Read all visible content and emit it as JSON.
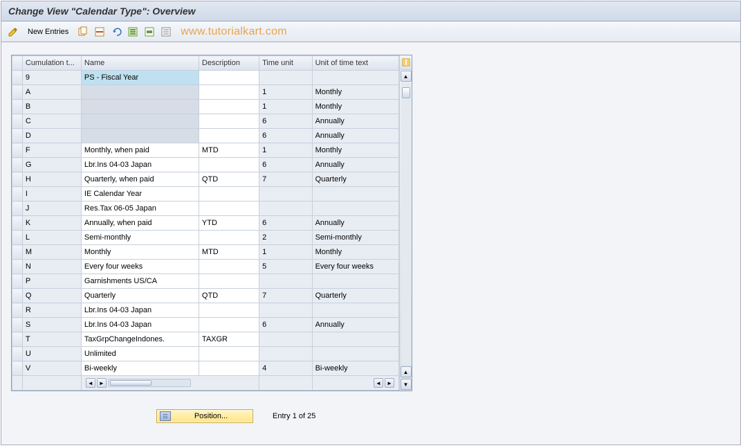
{
  "title": "Change View \"Calendar Type\": Overview",
  "toolbar": {
    "new_entries_label": "New Entries"
  },
  "watermark": "www.tutorialkart.com",
  "table": {
    "headers": {
      "cumulation": "Cumulation t...",
      "name": "Name",
      "description": "Description",
      "time_unit": "Time unit",
      "unit_of_time_text": "Unit of time text"
    },
    "rows": [
      {
        "ct": "9",
        "name": "PS - Fiscal Year",
        "desc": "",
        "tu": "",
        "uott": "",
        "selected": true
      },
      {
        "ct": "A",
        "name": "",
        "desc": "",
        "tu": "1",
        "uott": "Monthly"
      },
      {
        "ct": "B",
        "name": "",
        "desc": "",
        "tu": "1",
        "uott": "Monthly"
      },
      {
        "ct": "C",
        "name": "",
        "desc": "",
        "tu": "6",
        "uott": "Annually"
      },
      {
        "ct": "D",
        "name": "",
        "desc": "",
        "tu": "6",
        "uott": "Annually"
      },
      {
        "ct": "F",
        "name": "Monthly, when paid",
        "desc": "MTD",
        "tu": "1",
        "uott": "Monthly"
      },
      {
        "ct": "G",
        "name": "Lbr.Ins 04-03  Japan",
        "desc": "",
        "tu": "6",
        "uott": "Annually"
      },
      {
        "ct": "H",
        "name": "Quarterly, when paid",
        "desc": "QTD",
        "tu": "7",
        "uott": "Quarterly"
      },
      {
        "ct": "I",
        "name": "IE Calendar Year",
        "desc": "",
        "tu": "",
        "uott": ""
      },
      {
        "ct": "J",
        "name": "Res.Tax 06-05  Japan",
        "desc": "",
        "tu": "",
        "uott": ""
      },
      {
        "ct": "K",
        "name": "Annually, when paid",
        "desc": "YTD",
        "tu": "6",
        "uott": "Annually"
      },
      {
        "ct": "L",
        "name": "Semi-monthly",
        "desc": "",
        "tu": "2",
        "uott": "Semi-monthly"
      },
      {
        "ct": "M",
        "name": "Monthly",
        "desc": "MTD",
        "tu": "1",
        "uott": "Monthly"
      },
      {
        "ct": "N",
        "name": "Every four weeks",
        "desc": "",
        "tu": "5",
        "uott": "Every four weeks"
      },
      {
        "ct": "P",
        "name": "Garnishments US/CA",
        "desc": "",
        "tu": "",
        "uott": ""
      },
      {
        "ct": "Q",
        "name": "Quarterly",
        "desc": "QTD",
        "tu": "7",
        "uott": "Quarterly"
      },
      {
        "ct": "R",
        "name": "Lbr.Ins 04-03  Japan",
        "desc": "",
        "tu": "",
        "uott": ""
      },
      {
        "ct": "S",
        "name": "Lbr.Ins 04-03  Japan",
        "desc": "",
        "tu": "6",
        "uott": "Annually"
      },
      {
        "ct": "T",
        "name": "TaxGrpChangeIndones.",
        "desc": "TAXGR",
        "tu": "",
        "uott": ""
      },
      {
        "ct": "U",
        "name": "Unlimited",
        "desc": "",
        "tu": "",
        "uott": ""
      },
      {
        "ct": "V",
        "name": "Bi-weekly",
        "desc": "",
        "tu": "4",
        "uott": "Bi-weekly"
      }
    ]
  },
  "footer": {
    "position_label": "Position...",
    "entry_text": "Entry 1 of 25"
  }
}
